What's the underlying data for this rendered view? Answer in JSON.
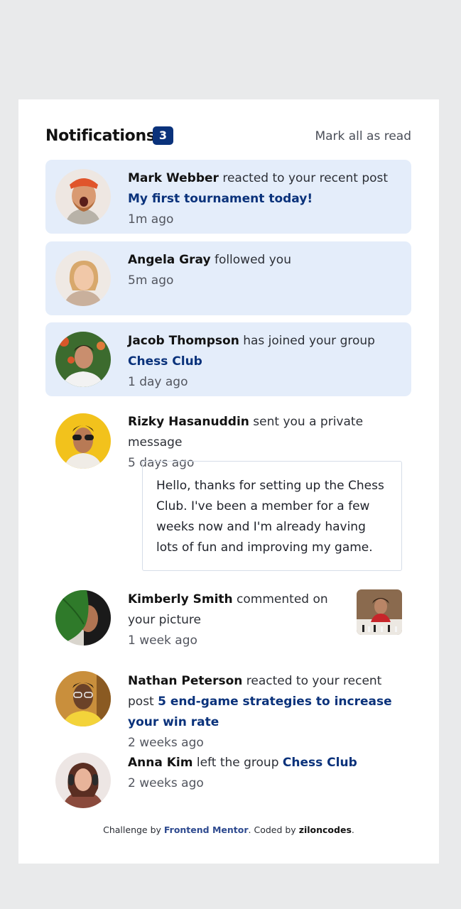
{
  "header": {
    "title": "Notifications",
    "unread_count": "3",
    "mark_all_label": "Mark all as read"
  },
  "notifications": [
    {
      "user": "Mark Webber",
      "action": "reacted to your recent post",
      "target": "My first tournament today!",
      "time": "1m ago",
      "unread": true
    },
    {
      "user": "Angela Gray",
      "action": "followed you",
      "time": "5m ago",
      "unread": true
    },
    {
      "user": "Jacob Thompson",
      "action": "has joined your group",
      "target": "Chess Club",
      "time": "1 day ago",
      "unread": true
    },
    {
      "user": "Rizky Hasanuddin",
      "action": "sent you a private message",
      "time": "5 days ago",
      "unread": false,
      "message": "Hello, thanks for setting up the Chess Club. I've been a member for a few weeks now and I'm already having lots of fun and improving my game."
    },
    {
      "user": "Kimberly Smith",
      "action": "commented on your picture",
      "time": "1 week ago",
      "unread": false
    },
    {
      "user": "Nathan Peterson",
      "action": "reacted to your recent post",
      "target": "5 end-game strategies to increase your win rate",
      "time": "2 weeks ago",
      "unread": false
    },
    {
      "user": "Anna Kim",
      "action": "left the group",
      "target": "Chess Club",
      "time": "2 weeks ago",
      "unread": false
    }
  ],
  "footer": {
    "prefix": "Challenge by",
    "link1": "Frontend Mentor",
    "middle": ". Coded by",
    "link2": "ziloncodes",
    "suffix": "."
  },
  "colors": {
    "page_bg": "#e9eaeb",
    "card_bg": "#ffffff",
    "unread_bg": "#e4edfa",
    "accent": "#0a327b"
  }
}
